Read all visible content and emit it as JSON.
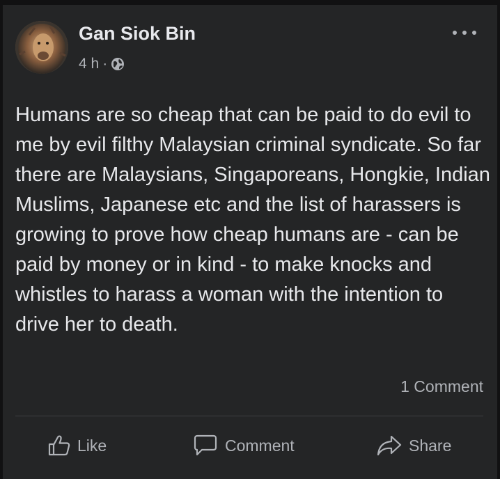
{
  "post": {
    "author": "Gan Siok Bin",
    "time": "4 h",
    "separator": "·",
    "audience_icon": "globe-icon",
    "more_icon": "more-options-icon",
    "text": "Humans are so cheap that can be paid to do evil to me by evil filthy Malaysian criminal syndicate. So far there are Malaysians, Singaporeans, Hongkie, Indian Muslims, Japanese etc and the list of harassers is growing to prove how cheap humans are - can be paid by money or in kind - to make knocks and whistles to harass a woman with the intention to drive her to death.",
    "comments_count": "1 Comment"
  },
  "actions": {
    "like": {
      "label": "Like",
      "icon": "thumbs-up-icon"
    },
    "comment": {
      "label": "Comment",
      "icon": "comment-bubble-icon"
    },
    "share": {
      "label": "Share",
      "icon": "share-arrow-icon"
    }
  },
  "colors": {
    "card_background": "#242526",
    "page_background": "#111112",
    "primary_text": "#e4e6eb",
    "secondary_text": "#b0b3b8",
    "divider": "#3e4042"
  }
}
